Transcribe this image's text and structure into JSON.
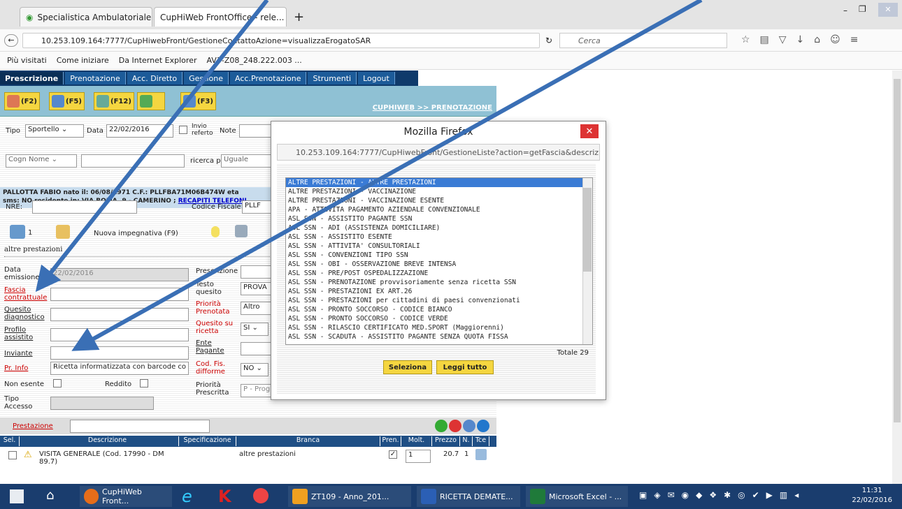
{
  "browser": {
    "tabs": [
      {
        "label": "Specialistica Ambulatoriale"
      },
      {
        "label": "CupHiWeb FrontOffice - rele..."
      }
    ],
    "url": "10.253.109.164:7777/CupHiwebFront/GestioneContattoAzione=visualizzaErogatoSAR",
    "search_placeholder": "Cerca",
    "bookmarks": [
      "Più visitati",
      "Come iniziare",
      "Da Internet Explorer",
      "AV3-Z08_248.222.003 ..."
    ]
  },
  "app": {
    "menu": [
      "Prescrizione",
      "Prenotazione",
      "Acc. Diretto",
      "Gestione",
      "Acc.Prenotazione",
      "Strumenti",
      "Logout"
    ],
    "fkeys": [
      "(F2)",
      "(F5)",
      "(F12)",
      "(F3)"
    ],
    "breadcrumb": "CUPHIWEB >> PRENOTAZIONE",
    "tipo_label": "Tipo",
    "tipo_value": "Sportello",
    "data_label": "Data",
    "data_value": "22/02/2016",
    "invio_referto_label": "Invio referto",
    "note_label": "Note",
    "cognome_select": "Cogn Nome",
    "ricerca_per_label": "ricerca per",
    "ricerca_per_value": "Uguale",
    "patient_line1": "PALLOTTA FABIO  nato il: 06/08/1971  C.F.: PLLFBA71M06B474W  eta",
    "patient_line2": "sms: NO  residente in: VIA ROMA, 9 - CAMERINO ; ",
    "recapiti_link": "RECAPITI TELEFONI",
    "nre_label": "NRE:",
    "codice_fiscale_label": "Codice Fiscale:",
    "codice_fiscale_value": "PLLF",
    "impegnativa_count": "1",
    "nuova_impegnativa": "Nuova impegnativa (F9)",
    "section_label": "altre prestazioni",
    "data_emissione_label": "Data emissione",
    "data_emissione_value": "22/02/2016",
    "fascia_label": "Fascia contrattuale",
    "quesito_label": "Quesito diagnostico",
    "profilo_label": "Profilo assistito",
    "inviante_label": "Inviante",
    "pr_info_label": "Pr. Info",
    "pr_info_value": "Ricetta informatizzata con barcode co",
    "non_esente_label": "Non esente",
    "reddito_label": "Reddito",
    "tipo_accesso_label": "Tipo Accesso",
    "prescrizione_label": "Prescrizione",
    "testo_quesito_label": "Testo quesito",
    "testo_quesito_value": "PROVA",
    "priorita_prenotata_label": "Priorità Prenotata",
    "priorita_prenotata_value": "Altro",
    "quesito_ricetta_label": "Quesito su ricetta",
    "quesito_ricetta_value": "SI",
    "ente_pagante_label": "Ente Pagante",
    "cod_fis_label": "Cod. Fis. difforme",
    "cod_fis_value": "NO",
    "priorita_prescritta_label": "Priorità Prescritta",
    "priorita_prescritta_value": "P - Prog"
  },
  "dialog": {
    "title": "Mozilla Firefox",
    "url": "10.253.109.164:7777/CupHiwebFront/GestioneListe?action=getFascia&descrizione=",
    "items": [
      "ALTRE PRESTAZIONI - ALTRE PRESTAZIONI",
      "ALTRE PRESTAZIONI - VACCINAZIONE",
      "ALTRE PRESTAZIONI - VACCINAZIONE ESENTE",
      "APA - ATTIVITA PAGAMENTO AZIENDALE CONVENZIONALE",
      "ASL SSN - ASSISTITO PAGANTE SSN",
      "ASL SSN - ADI (ASSISTENZA DOMICILIARE)",
      "ASL SSN - ASSISTITO ESENTE",
      "ASL SSN - ATTIVITA' CONSULTORIALI",
      "ASL SSN - CONVENZIONI TIPO SSN",
      "ASL SSN - OBI - OSSERVAZIONE BREVE INTENSA",
      "ASL SSN - PRE/POST OSPEDALIZZAZIONE",
      "ASL SSN - PRENOTAZIONE provvisoriamente senza ricetta SSN",
      "ASL SSN - PRESTAZIONI EX ART.26",
      "ASL SSN - PRESTAZIONI per cittadini di paesi convenzionati",
      "ASL SSN - PRONTO SOCCORSO - CODICE BIANCO",
      "ASL SSN - PRONTO SOCCORSO - CODICE VERDE",
      "ASL SSN - RILASCIO CERTIFICATO MED.SPORT (Maggiorenni)",
      "ASL SSN - SCADUTA - ASSISTITO PAGANTE SENZA QUOTA FISSA"
    ],
    "totale": "Totale 29",
    "seleziona": "Seleziona",
    "leggi_tutto": "Leggi tutto"
  },
  "prestazioni": {
    "label": "Prestazione",
    "headers": [
      "Sel.",
      "Descrizione",
      "Specificazione",
      "Branca",
      "Pren.",
      "Molt.",
      "Prezzo",
      "N.",
      "Tce"
    ],
    "row": {
      "descrizione": "VISITA GENERALE (Cod. 17990 - DM 89.7)",
      "branca": "altre prestazioni",
      "molt": "1",
      "prezzo": "20.7",
      "n": "1"
    }
  },
  "taskbar": {
    "items": [
      "CupHiWeb Front...",
      "ZT109 - Anno_201...",
      "RICETTA DEMATE...",
      "Microsoft Excel - ..."
    ],
    "time": "11:31",
    "date": "22/02/2016"
  },
  "colors": {
    "menu_bg": "#0f3a6b",
    "toolbar_bg": "#8fc1d4",
    "arrow": "#3a6fb5",
    "selected_item": "#3a7bd5"
  }
}
